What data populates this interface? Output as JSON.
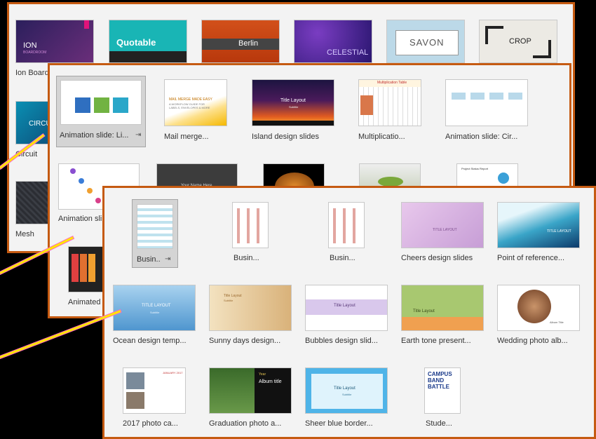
{
  "colors": {
    "panel_border": "#c55a11",
    "panel_bg": "#f3f3f3",
    "arrow": "#ffe600",
    "arrow_edge": "#ff66c4"
  },
  "panel_back": {
    "tiles": [
      {
        "label": "Ion Boardroom",
        "thumb_text": "ION",
        "thumb_sub": "BOARDROOM"
      },
      {
        "label": "",
        "thumb_text": "Quotable"
      },
      {
        "label": "",
        "thumb_text": "Berlin"
      },
      {
        "label": "",
        "thumb_text": "CELESTIAL"
      },
      {
        "label": "",
        "thumb_text": "SAVON"
      },
      {
        "label": "",
        "thumb_text": "CROP"
      },
      {
        "label": "Circuit",
        "thumb_text": "CIRCU"
      },
      {
        "label": "Mesh",
        "thumb_text": "M"
      }
    ]
  },
  "panel_mid": {
    "tiles": [
      {
        "label": "Animation slide: Li...",
        "selected": true,
        "pin": "⇥",
        "thumb_boxes": [
          "text",
          "text",
          "text"
        ]
      },
      {
        "label": "Mail merge...",
        "thumb_lines": [
          "MAIL MERGE MADE EASY",
          "A WORKFLOW GUIDE FOR",
          "LABELS, ENVELOPES & MORE"
        ]
      },
      {
        "label": "Island design slides",
        "thumb_text": "Title Layout",
        "thumb_sub": "Subtitle"
      },
      {
        "label": "Multiplicatio...",
        "thumb_text": "Multiplication Table"
      },
      {
        "label": "Animation slide: Cir...",
        "thumb_boxes": [
          "text",
          "text",
          "text",
          "text"
        ]
      },
      {
        "label": "Animation sli"
      },
      {
        "label": "",
        "thumb_text": "Your Name Here"
      },
      {
        "label": ""
      },
      {
        "label": ""
      },
      {
        "label": "",
        "thumb_text": "Project Status Report"
      },
      {
        "label": "Animated"
      }
    ]
  },
  "panel_front": {
    "tiles": [
      {
        "label": "Busin...",
        "selected": true,
        "pin": "⇥"
      },
      {
        "label": "Busin..."
      },
      {
        "label": "Busin..."
      },
      {
        "label": "Cheers design slides",
        "thumb_text": "TITLE LAYOUT"
      },
      {
        "label": "Point of reference...",
        "thumb_text": "TITLE LAYOUT"
      },
      {
        "label": "Ocean design temp...",
        "thumb_text": "TITLE LAYOUT",
        "thumb_sub": "Subtitle"
      },
      {
        "label": "Sunny days design...",
        "thumb_text": "Title Layout",
        "thumb_sub": "Subtitle"
      },
      {
        "label": "Bubbles design slid...",
        "thumb_text": "Title Layout"
      },
      {
        "label": "Earth tone present...",
        "thumb_text": "Title Layout"
      },
      {
        "label": "Wedding photo alb...",
        "thumb_text": "Album Title"
      },
      {
        "label": "2017 photo ca...",
        "thumb_text": "JANUARY 2017"
      },
      {
        "label": "Graduation photo a...",
        "thumb_text": "Album title",
        "thumb_sub": "Year"
      },
      {
        "label": "Sheer blue border...",
        "thumb_text": "Title Layout",
        "thumb_sub": "Subtitle"
      },
      {
        "label": "Stude...",
        "thumb_lines": [
          "CAMPUS",
          "BAND",
          "BATTLE"
        ]
      }
    ]
  }
}
